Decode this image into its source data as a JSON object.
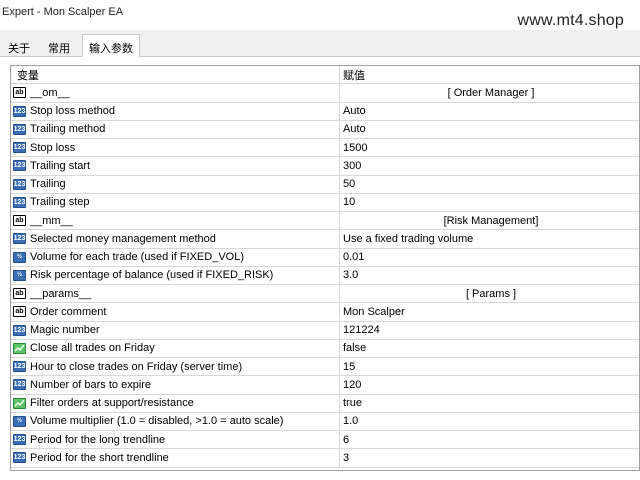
{
  "window": {
    "title": "Expert - Mon Scalper EA"
  },
  "watermark": "www.mt4.shop",
  "tabs": [
    {
      "label": "关于",
      "active": false
    },
    {
      "label": "常用",
      "active": false
    },
    {
      "label": "输入参数",
      "active": true
    }
  ],
  "table": {
    "headers": {
      "variable": "变量",
      "value": "赋值"
    },
    "rows": [
      {
        "icon": "string",
        "name": "__om__",
        "value": "[ Order Manager ]",
        "align": "center"
      },
      {
        "icon": "int",
        "name": "Stop loss method",
        "value": "Auto"
      },
      {
        "icon": "int",
        "name": "Trailing method",
        "value": "Auto"
      },
      {
        "icon": "int",
        "name": "Stop loss",
        "value": "1500"
      },
      {
        "icon": "int",
        "name": "Trailing start",
        "value": "300"
      },
      {
        "icon": "int",
        "name": "Trailing",
        "value": "50"
      },
      {
        "icon": "int",
        "name": "Trailing step",
        "value": "10"
      },
      {
        "icon": "string",
        "name": "__mm__",
        "value": "[Risk Management]",
        "align": "center"
      },
      {
        "icon": "int",
        "name": "Selected money management method",
        "value": "Use a fixed trading volume"
      },
      {
        "icon": "double",
        "name": "Volume for each trade (used if FIXED_VOL)",
        "value": "0.01"
      },
      {
        "icon": "double",
        "name": "Risk percentage of balance (used if FIXED_RISK)",
        "value": "3.0"
      },
      {
        "icon": "string",
        "name": "__params__",
        "value": "[ Params ]",
        "align": "center"
      },
      {
        "icon": "string",
        "name": "Order comment",
        "value": "Mon Scalper"
      },
      {
        "icon": "int",
        "name": "Magic number",
        "value": "121224"
      },
      {
        "icon": "bool",
        "name": "Close all trades on Friday",
        "value": "false"
      },
      {
        "icon": "int",
        "name": "Hour to close trades on Friday (server time)",
        "value": "15"
      },
      {
        "icon": "int",
        "name": "Number of bars to expire",
        "value": "120"
      },
      {
        "icon": "bool",
        "name": "Filter orders at support/resistance",
        "value": "true"
      },
      {
        "icon": "double",
        "name": "Volume multiplier (1.0 = disabled, >1.0 = auto scale)",
        "value": "1.0"
      },
      {
        "icon": "int",
        "name": "Period for the long trendline",
        "value": "6"
      },
      {
        "icon": "int",
        "name": "Period for the short trendline",
        "value": "3"
      }
    ]
  }
}
